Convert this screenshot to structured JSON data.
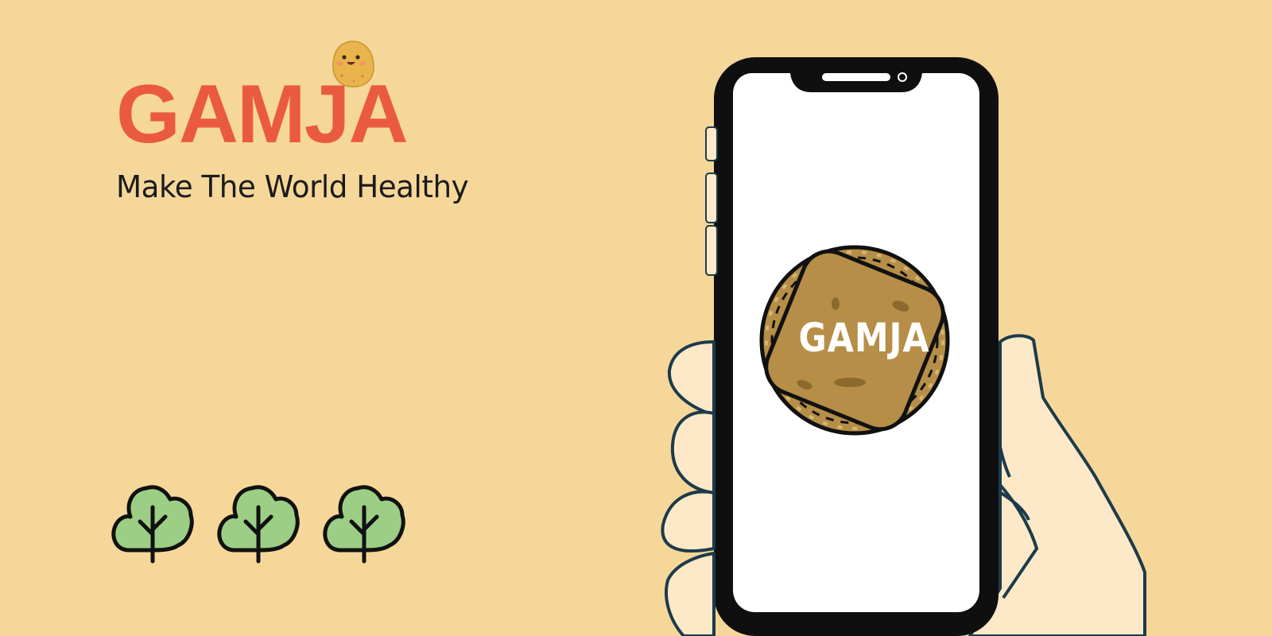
{
  "brand": {
    "name": "GAMJA",
    "tagline": "Make The World Healthy"
  },
  "app_icon": {
    "label": "GAMJA"
  },
  "decor": {
    "mascot_icon": "potato-mascot-icon",
    "tree_icons": [
      "tree-icon",
      "tree-icon",
      "tree-icon"
    ],
    "phone": "smartphone-in-hand"
  },
  "colors": {
    "background": "#f6d79a",
    "brand_red": "#ea5a3f",
    "potato": "#b68e47",
    "tree_green": "#9cce85",
    "skin": "#fde9c8"
  }
}
